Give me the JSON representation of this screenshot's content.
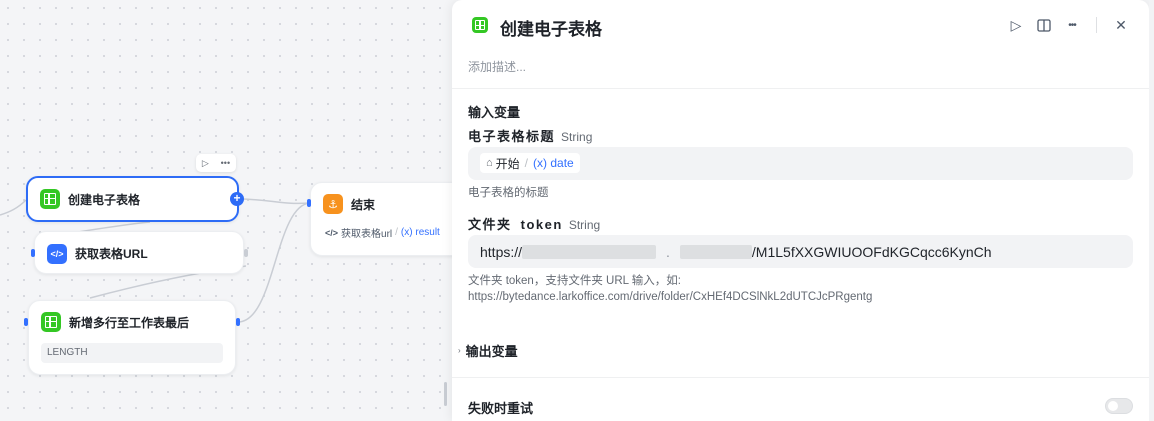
{
  "canvas": {
    "nodes": {
      "create_sheet": {
        "title": "创建电子表格"
      },
      "get_url": {
        "title": "获取表格URL"
      },
      "append_rows": {
        "title": "新增多行至工作表最后",
        "param": "LENGTH"
      },
      "end": {
        "title": "结束",
        "output_label": "获取表格url",
        "output_var": "(x) result"
      }
    }
  },
  "panel": {
    "title": "创建电子表格",
    "description_placeholder": "添加描述...",
    "inputs_section": "输入变量",
    "sheet_title_field": {
      "label": "电子表格标题",
      "type": "String",
      "chip_source": "开始",
      "chip_var": "(x) date",
      "hint": "电子表格的标题"
    },
    "folder_token_field": {
      "label_prefix": "文件夹",
      "label_token": "token",
      "type": "String",
      "value_prefix": "https://",
      "value_suffix": "/M1L5fXXGWIUOOFdKGCqcc6KynCh",
      "hint_line1": "文件夹 token，支持文件夹 URL 输入，如:",
      "hint_line2": "https://bytedance.larkoffice.com/drive/folder/CxHEf4DCSlNkL2dUTCJcPRgentg"
    },
    "outputs_section": "输出变量",
    "retry_label": "失败时重试",
    "retry_enabled": false
  }
}
